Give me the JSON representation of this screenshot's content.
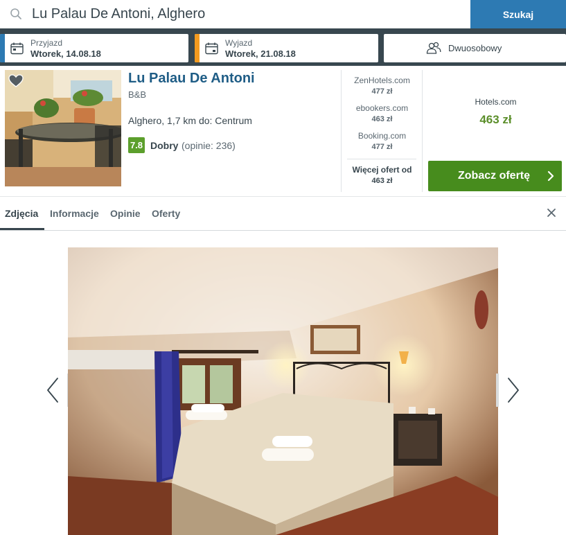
{
  "search": {
    "value": "Lu Palau De Antoni, Alghero",
    "button_label": "Szukaj"
  },
  "filters": {
    "checkin": {
      "label": "Przyjazd",
      "value": "Wtorek, 14.08.18",
      "accent": "#2d7ab3"
    },
    "checkout": {
      "label": "Wyjazd",
      "value": "Wtorek, 21.08.18",
      "accent": "#f29a1f"
    },
    "guests": {
      "value": "Dwuosobowy"
    }
  },
  "hotel": {
    "name": "Lu Palau De Antoni",
    "type": "B&B",
    "location": "Alghero, 1,7 km do: Centrum",
    "rating": "7.8",
    "rating_word": "Dobry",
    "reviews": "(opinie: 236)"
  },
  "deals": [
    {
      "site": "ZenHotels.com",
      "price": "477 zł"
    },
    {
      "site": "ebookers.com",
      "price": "463 zł"
    },
    {
      "site": "Booking.com",
      "price": "477 zł"
    }
  ],
  "more_offers": {
    "label": "Więcej ofert od",
    "price": "463 zł"
  },
  "best_deal": {
    "site": "Hotels.com",
    "price": "463 zł",
    "cta_label": "Zobacz ofertę"
  },
  "tabs": [
    "Zdjęcia",
    "Informacje",
    "Opinie",
    "Oferty"
  ],
  "active_tab": "Zdjęcia",
  "colors": {
    "primary": "#2d7ab3",
    "header_band": "#38474f",
    "rating_green": "#5c9f2c",
    "cta_green": "#478c1d",
    "price_green": "#5c8f2b",
    "hotel_name": "#1f5d86"
  },
  "icons": [
    "search-icon",
    "calendar-icon",
    "people-icon",
    "heart-icon",
    "chevron-right-icon",
    "close-icon",
    "arrow-left-icon",
    "arrow-right-icon"
  ]
}
